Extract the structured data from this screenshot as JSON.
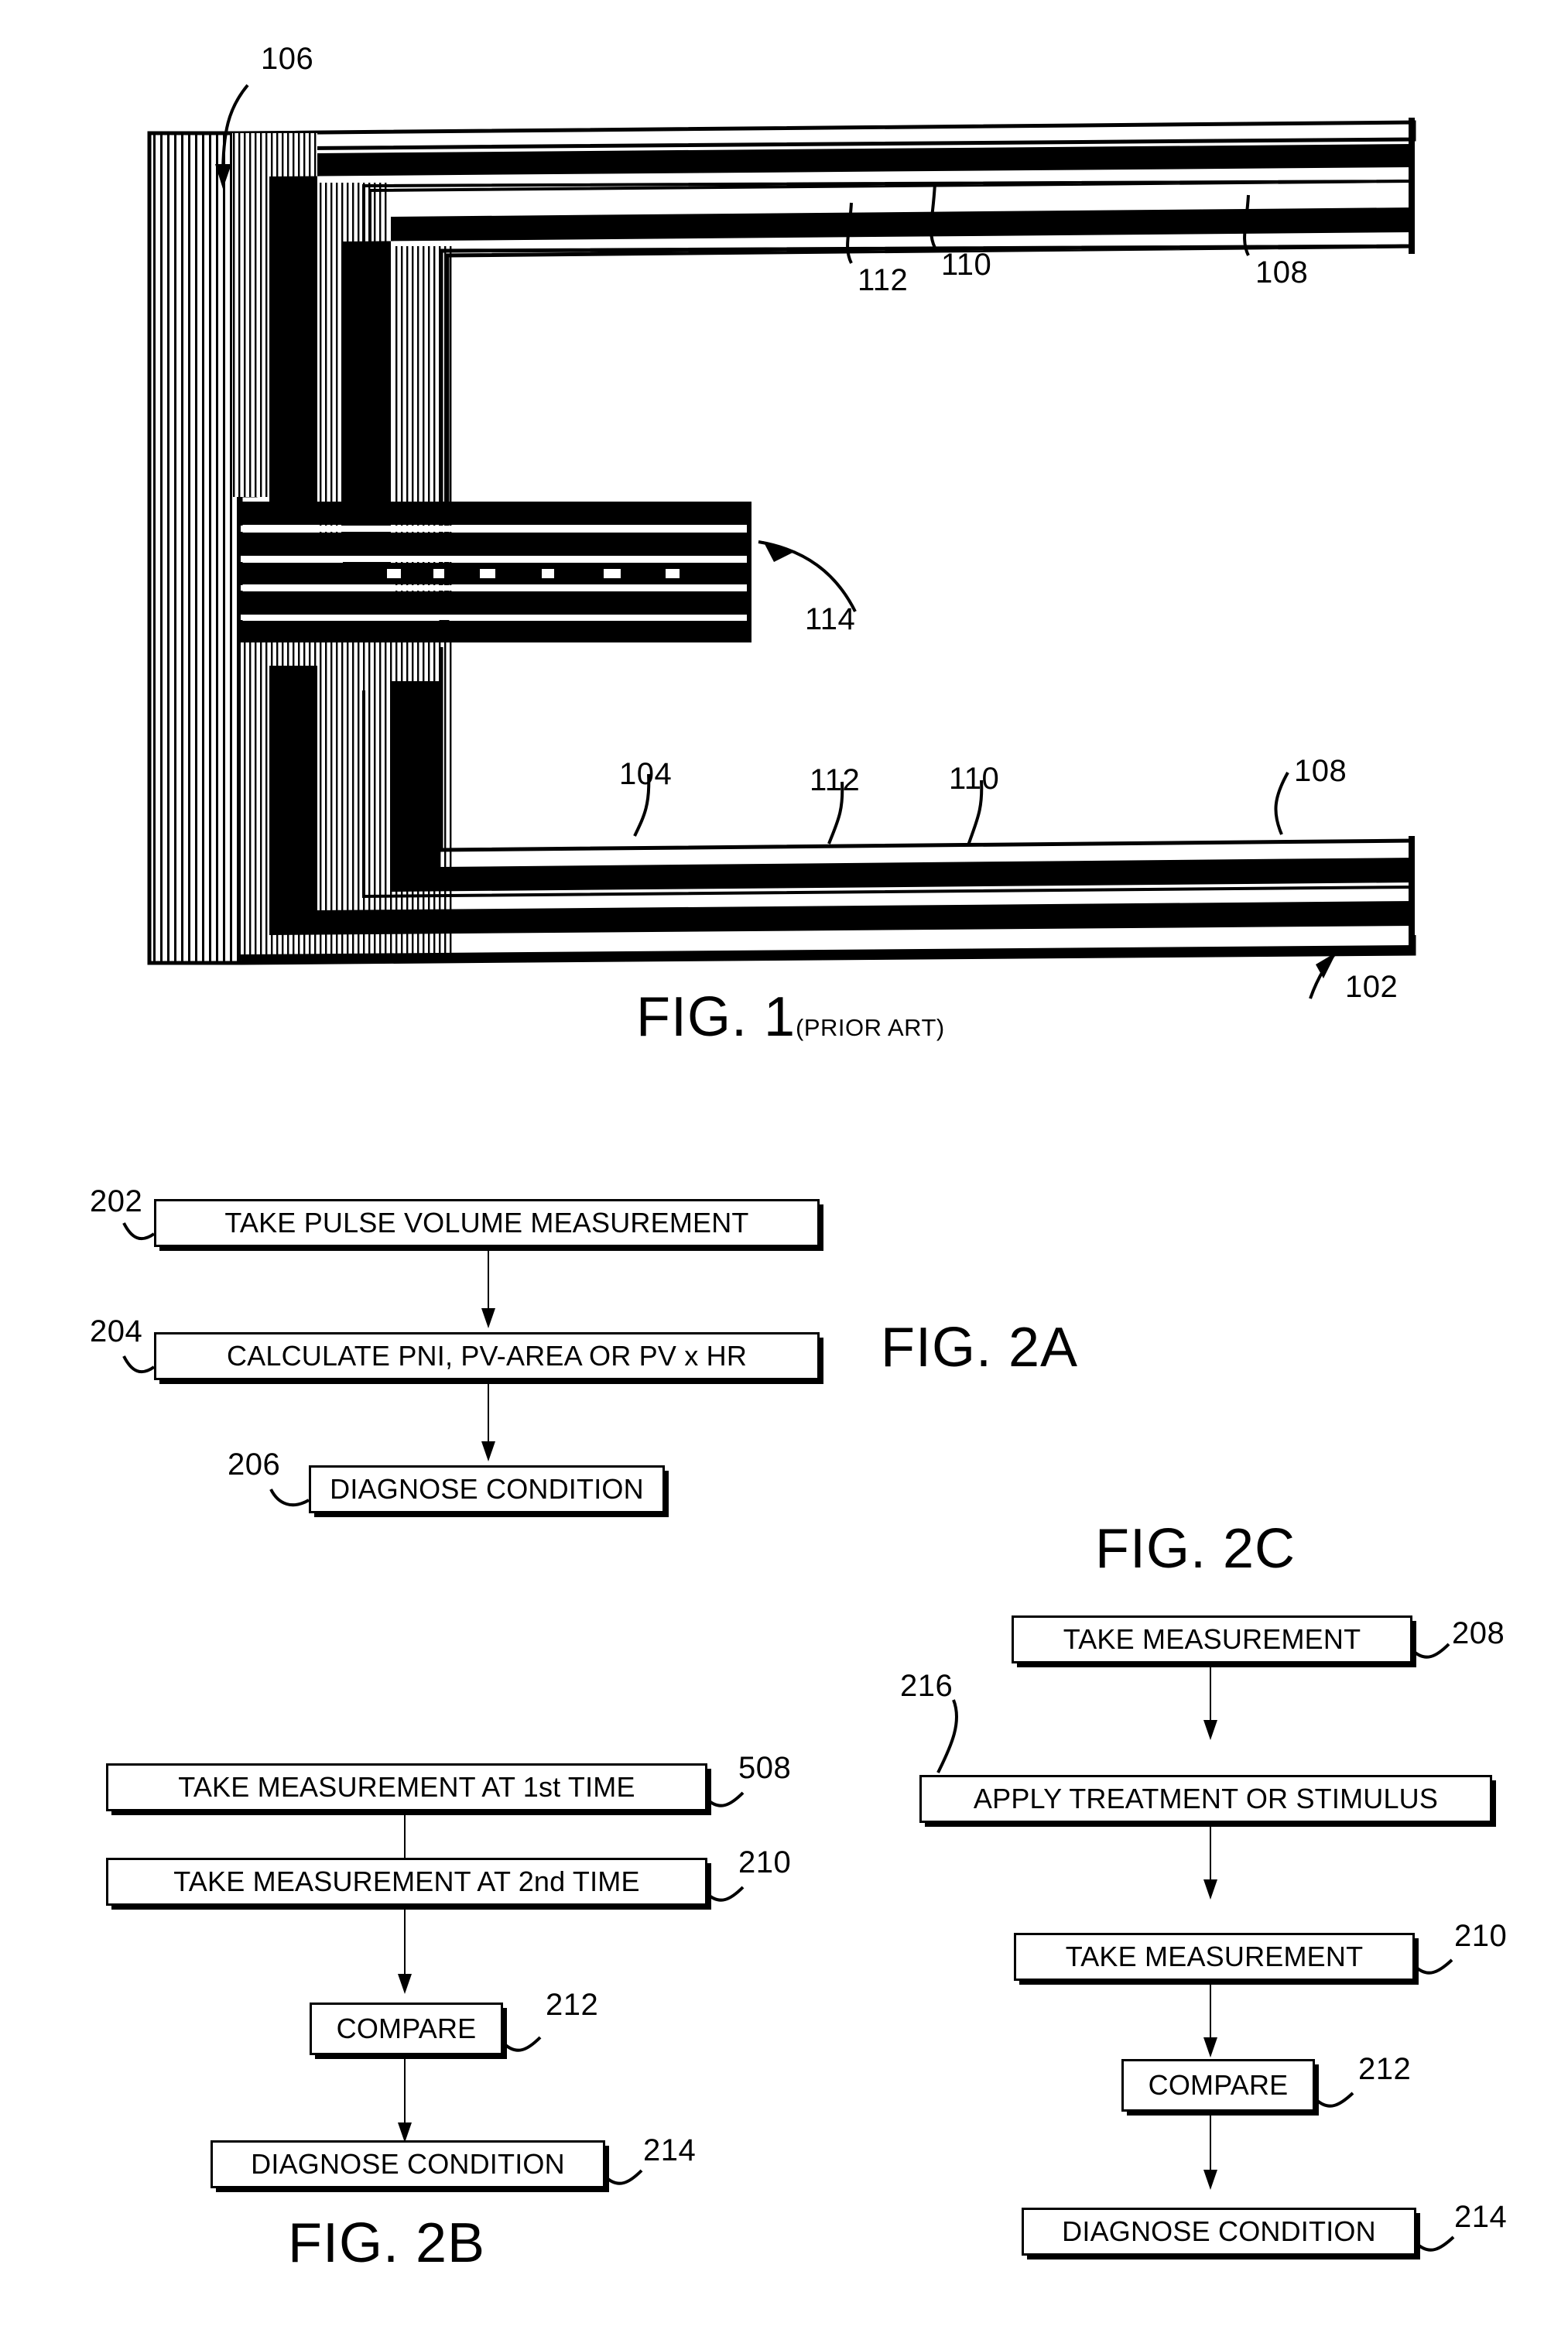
{
  "document": {
    "type": "patent-drawing-sheet",
    "background_color": "#ffffff",
    "ink_color": "#000000"
  },
  "figures": [
    {
      "id": "fig1",
      "title": "FIG. 1",
      "subtitle": "(PRIOR ART)",
      "description": "Cross-sectional view of a prior-art multilayer cuff / sensor assembly with hatched substrate block and layered arms",
      "callouts": [
        {
          "ref": "106",
          "target": "hatched-substrate-block"
        },
        {
          "ref": "112",
          "target": "upper-arm-inner-layer"
        },
        {
          "ref": "110",
          "target": "upper-arm-middle-layer"
        },
        {
          "ref": "108",
          "target": "upper-arm-outer-layer"
        },
        {
          "ref": "114",
          "target": "center-fork-tip"
        },
        {
          "ref": "104",
          "target": "lower-arm-body"
        },
        {
          "ref": "112",
          "target": "lower-arm-inner-layer"
        },
        {
          "ref": "110",
          "target": "lower-arm-middle-layer"
        },
        {
          "ref": "108",
          "target": "lower-arm-outer-layer"
        },
        {
          "ref": "102",
          "target": "assembly-overall"
        }
      ]
    },
    {
      "id": "fig2a",
      "title": "FIG. 2A",
      "steps": [
        {
          "ref": "202",
          "label": "TAKE PULSE VOLUME MEASUREMENT"
        },
        {
          "ref": "204",
          "label": "CALCULATE PNI, PV-AREA OR PV x HR"
        },
        {
          "ref": "206",
          "label": "DIAGNOSE CONDITION"
        }
      ]
    },
    {
      "id": "fig2b",
      "title": "FIG. 2B",
      "steps": [
        {
          "ref": "508",
          "label": "TAKE MEASUREMENT AT 1st TIME"
        },
        {
          "ref": "210",
          "label": "TAKE MEASUREMENT AT 2nd TIME"
        },
        {
          "ref": "212",
          "label": "COMPARE"
        },
        {
          "ref": "214",
          "label": "DIAGNOSE CONDITION"
        }
      ]
    },
    {
      "id": "fig2c",
      "title": "FIG. 2C",
      "steps": [
        {
          "ref": "208",
          "label": "TAKE MEASUREMENT"
        },
        {
          "ref": "216",
          "label": "APPLY TREATMENT OR STIMULUS"
        },
        {
          "ref": "210",
          "label": "TAKE MEASUREMENT"
        },
        {
          "ref": "212",
          "label": "COMPARE"
        },
        {
          "ref": "214",
          "label": "DIAGNOSE CONDITION"
        }
      ]
    }
  ]
}
